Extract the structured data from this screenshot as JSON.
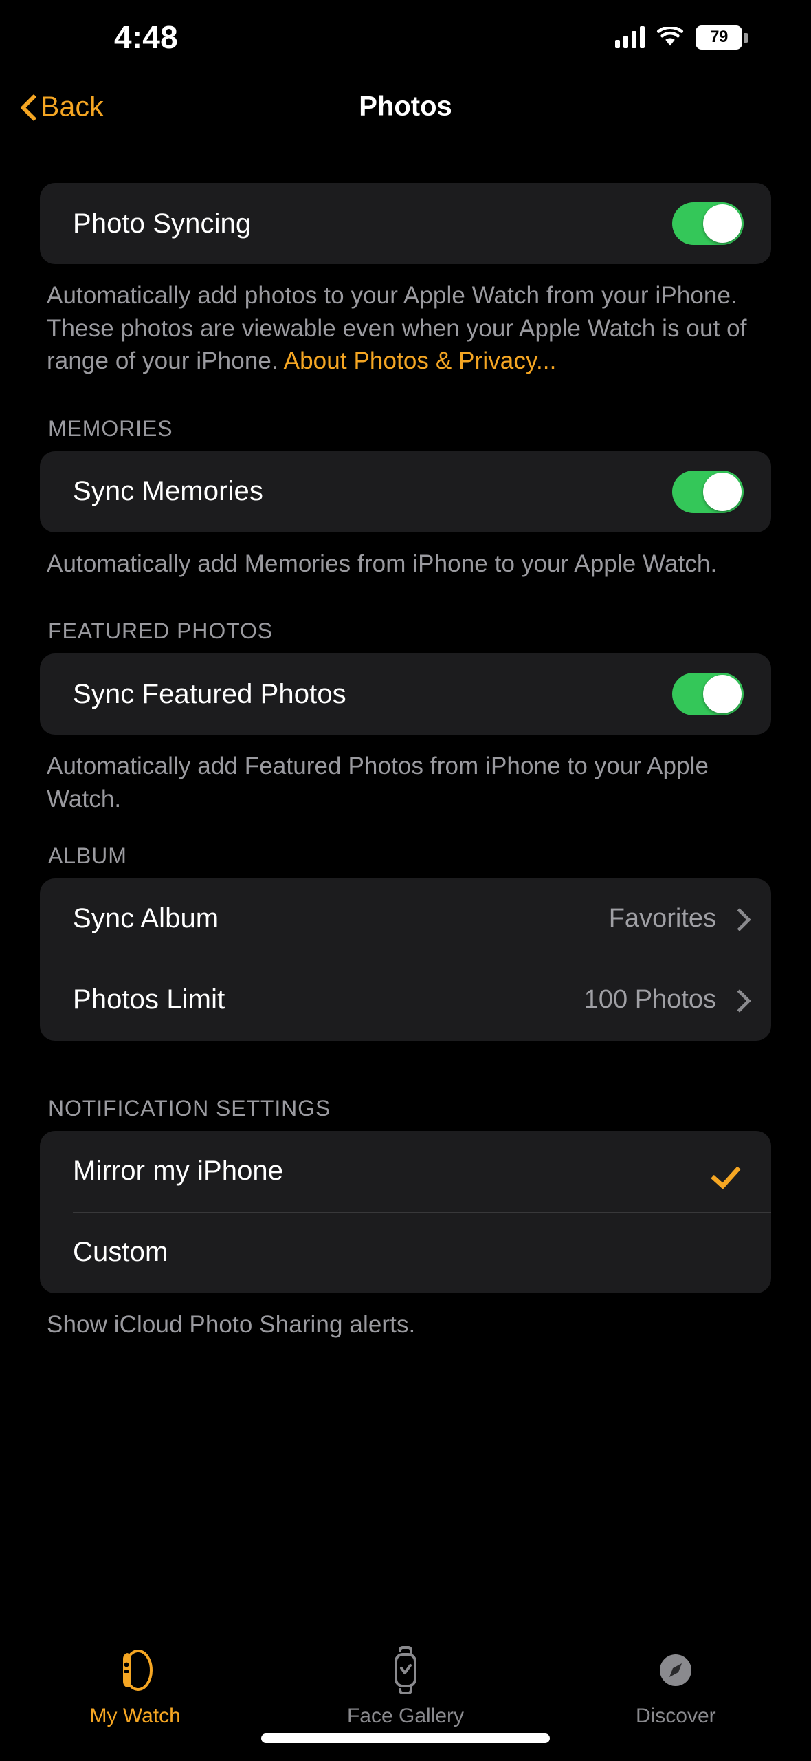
{
  "status_bar": {
    "time": "4:48",
    "battery_level": "79",
    "cellular_icon": "cellular-signal-icon",
    "wifi_icon": "wifi-icon",
    "battery_icon": "battery-icon"
  },
  "nav": {
    "back_label": "Back",
    "back_icon": "chevron-left-icon",
    "title": "Photos"
  },
  "sections": {
    "photo_syncing": {
      "row_label": "Photo Syncing",
      "toggle_state": "on",
      "footer_text": "Automatically add photos to your Apple Watch from your iPhone. These photos are viewable even when your Apple Watch is out of range of your iPhone. ",
      "footer_link": "About Photos & Privacy..."
    },
    "memories": {
      "header": "MEMORIES",
      "row_label": "Sync Memories",
      "toggle_state": "on",
      "footer_text": "Automatically add Memories from iPhone to your Apple Watch."
    },
    "featured_photos": {
      "header": "FEATURED PHOTOS",
      "row_label": "Sync Featured Photos",
      "toggle_state": "on",
      "footer_text": "Automatically add Featured Photos from iPhone to your Apple Watch."
    },
    "album": {
      "header": "ALBUM",
      "rows": [
        {
          "label": "Sync Album",
          "value": "Favorites"
        },
        {
          "label": "Photos Limit",
          "value": "100 Photos"
        }
      ]
    },
    "notification_settings": {
      "header": "NOTIFICATION SETTINGS",
      "rows": [
        {
          "label": "Mirror my iPhone",
          "selected": true
        },
        {
          "label": "Custom",
          "selected": false
        }
      ],
      "footer_text": "Show iCloud Photo Sharing alerts."
    }
  },
  "tab_bar": {
    "tabs": [
      {
        "label": "My Watch",
        "icon": "watch-side-icon",
        "active": true
      },
      {
        "label": "Face Gallery",
        "icon": "watch-face-icon",
        "active": false
      },
      {
        "label": "Discover",
        "icon": "compass-icon",
        "active": false
      }
    ]
  },
  "colors": {
    "accent_orange": "#f5a623",
    "toggle_green": "#34c759",
    "card_bg": "#1c1c1e",
    "page_bg": "#000000",
    "secondary_text": "#9a9a9f"
  }
}
